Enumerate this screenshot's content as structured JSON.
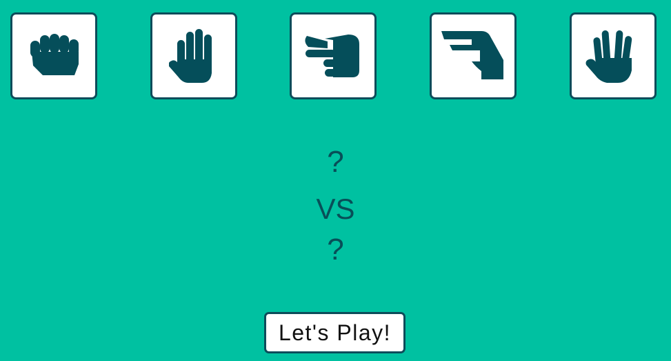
{
  "choices": [
    {
      "id": "rock",
      "icon": "fist-hand-icon"
    },
    {
      "id": "paper",
      "icon": "open-hand-icon"
    },
    {
      "id": "scissors",
      "icon": "scissors-hand-icon"
    },
    {
      "id": "lizard",
      "icon": "lizard-hand-icon"
    },
    {
      "id": "spock",
      "icon": "spock-hand-icon"
    }
  ],
  "matchup": {
    "player_pick": "?",
    "vs": "VS",
    "computer_pick": "?"
  },
  "play_button": {
    "label": "Let's Play!"
  },
  "colors": {
    "background": "#00c1a1",
    "accent": "#054e5a",
    "card": "#ffffff"
  }
}
